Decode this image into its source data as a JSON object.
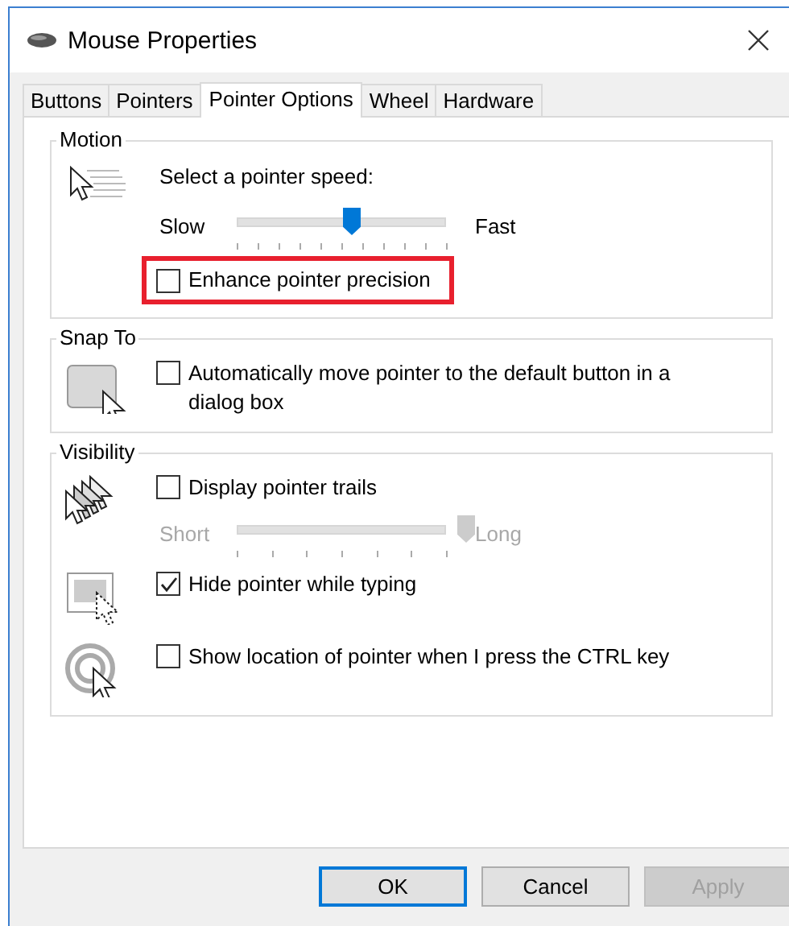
{
  "window": {
    "title": "Mouse Properties"
  },
  "tabs": [
    {
      "label": "Buttons",
      "selected": false
    },
    {
      "label": "Pointers",
      "selected": false
    },
    {
      "label": "Pointer Options",
      "selected": true
    },
    {
      "label": "Wheel",
      "selected": false
    },
    {
      "label": "Hardware",
      "selected": false
    }
  ],
  "groups": [
    {
      "title": "Motion",
      "sections": [
        {
          "items": [
            {
              "kind": "label",
              "text": "Select a pointer speed:"
            },
            {
              "kind": "slider",
              "min_label": "Slow",
              "max_label": "Fast",
              "level": 0.5,
              "disabled": false
            },
            {
              "kind": "checkbox",
              "label": "Enhance pointer precision",
              "checked": false,
              "highlighted": true
            }
          ]
        }
      ]
    },
    {
      "title": "Snap To",
      "sections": [
        {
          "items": [
            {
              "kind": "checkbox",
              "label": "Automatically move pointer to the default button in a dialog box",
              "checked": false,
              "highlighted": false
            }
          ]
        }
      ]
    },
    {
      "title": "Visibility",
      "sections": [
        {
          "items": [
            {
              "kind": "checkbox",
              "label": "Display pointer trails",
              "checked": false,
              "highlighted": false
            },
            {
              "kind": "slider",
              "min_label": "Short",
              "max_label": "Long",
              "level": 1,
              "disabled": true
            }
          ]
        },
        {
          "items": [
            {
              "kind": "checkbox",
              "label": "Hide pointer while typing",
              "checked": true,
              "highlighted": false
            }
          ]
        },
        {
          "items": [
            {
              "kind": "checkbox",
              "label": "Show location of pointer when I press the CTRL key",
              "checked": false,
              "highlighted": false
            }
          ]
        }
      ]
    }
  ],
  "buttons": [
    {
      "label": "OK",
      "default": true,
      "disabled": false
    },
    {
      "label": "Cancel",
      "default": false,
      "disabled": false
    },
    {
      "label": "Apply",
      "default": false,
      "disabled": true
    }
  ]
}
